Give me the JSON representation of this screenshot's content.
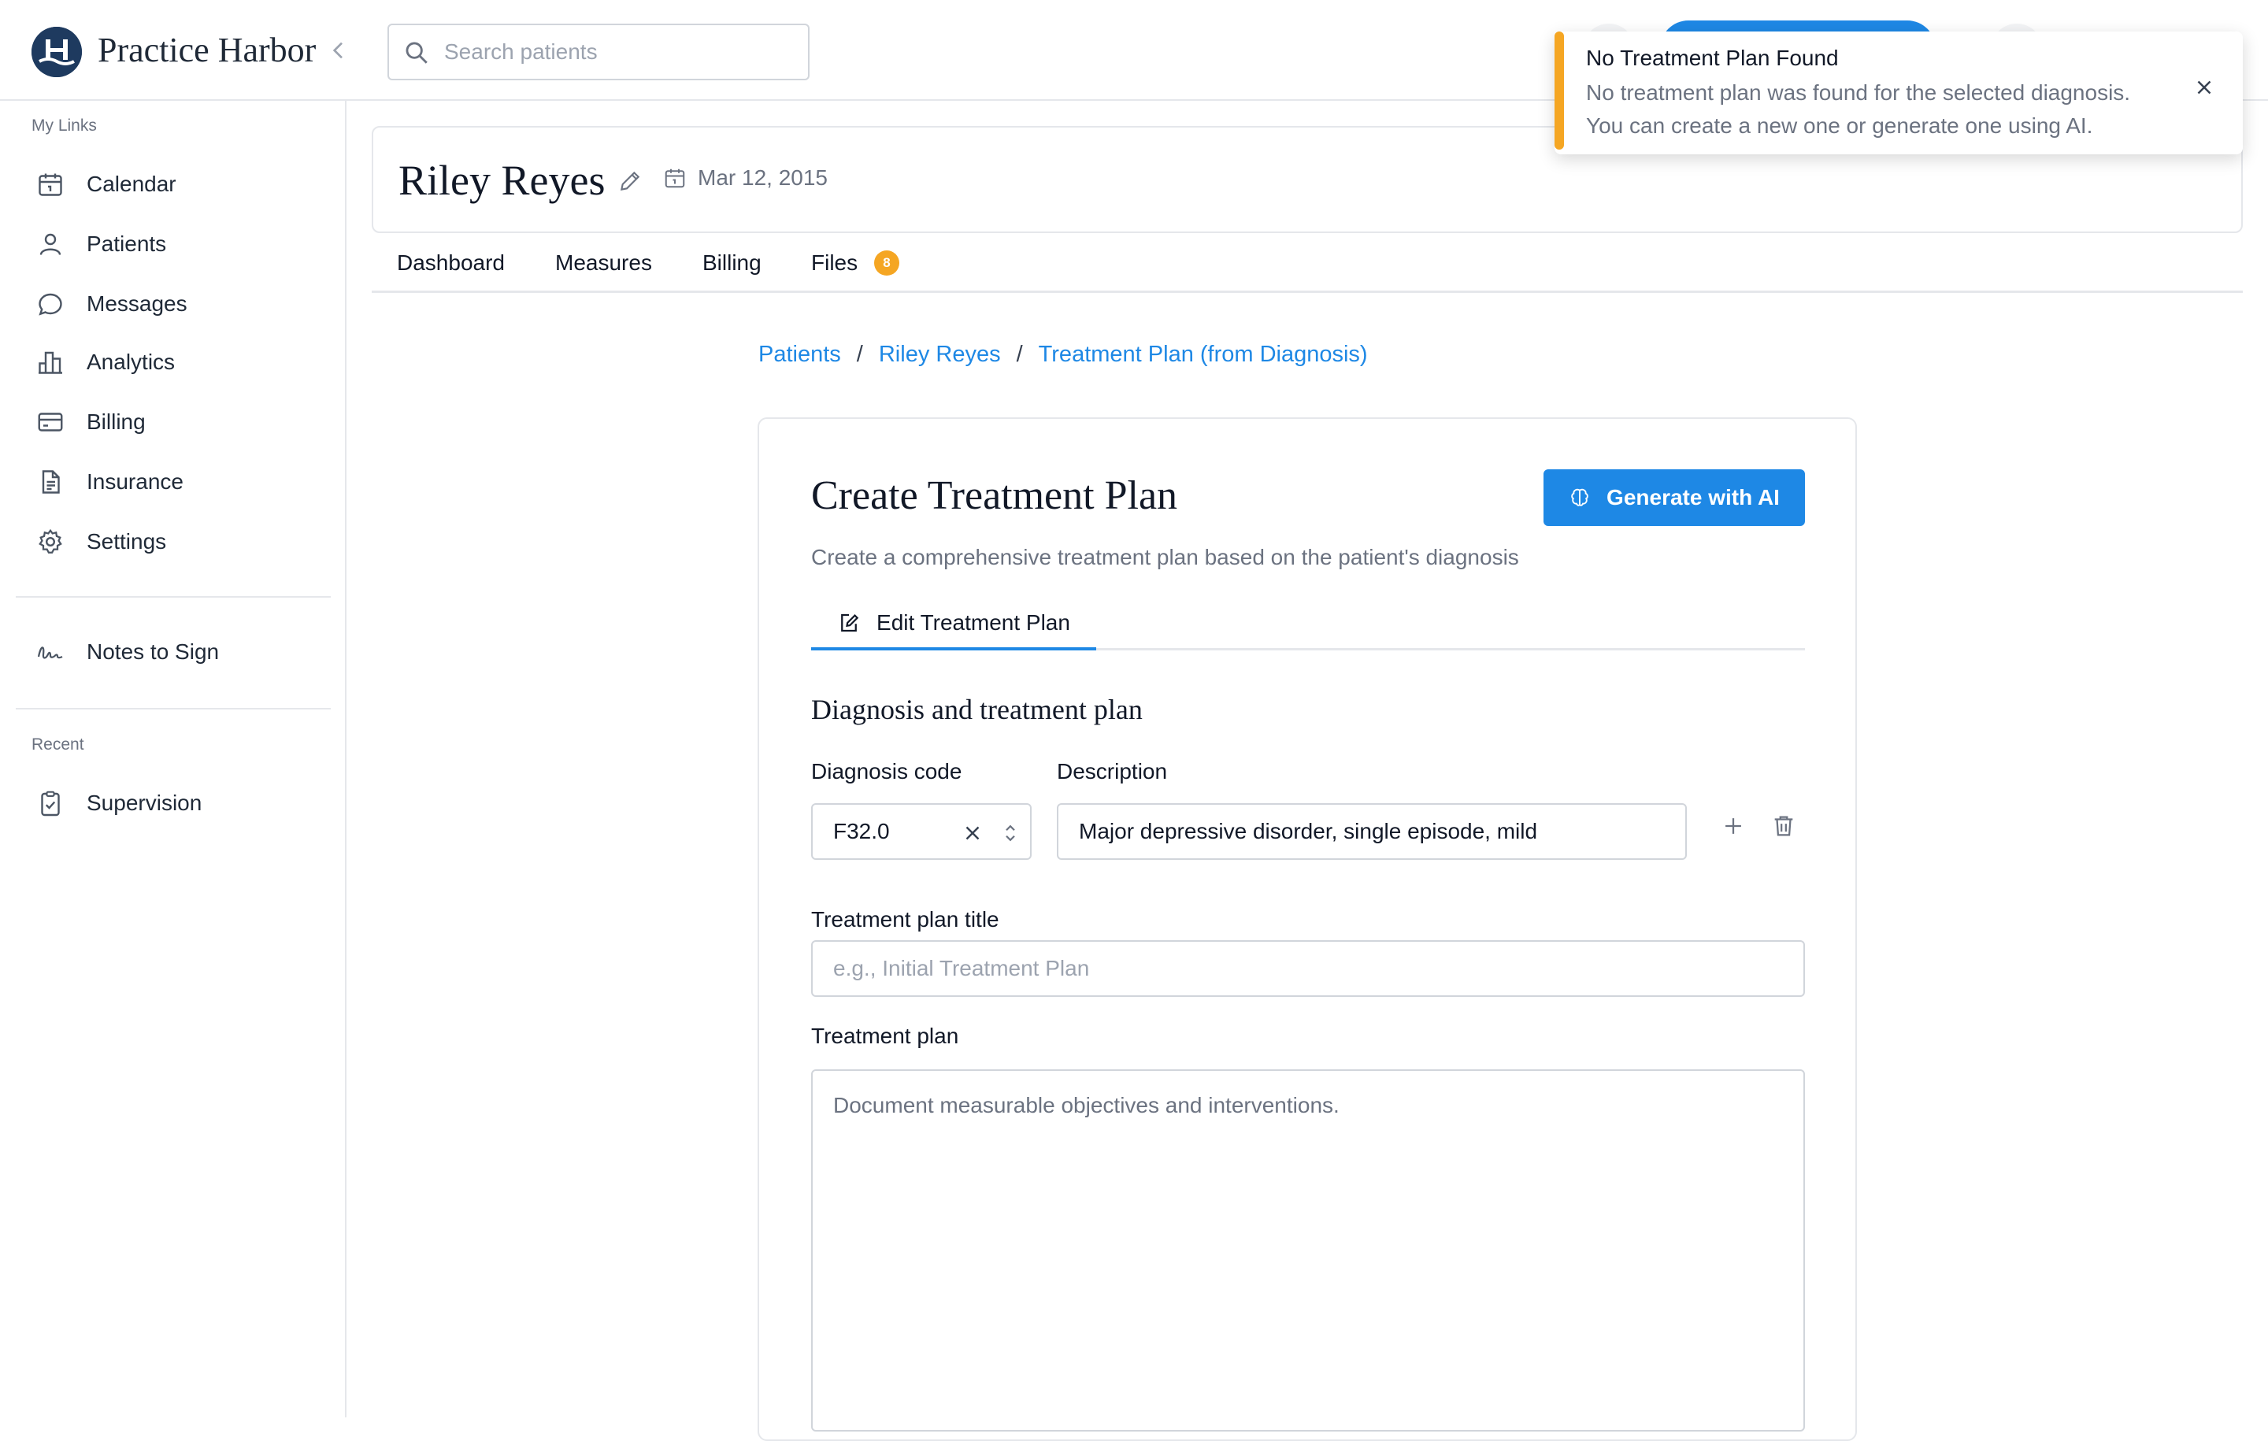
{
  "app": {
    "brand": "Practice Harbor"
  },
  "search": {
    "placeholder": "Search patients"
  },
  "sidebar": {
    "section_links": "My Links",
    "items": [
      {
        "label": "Calendar",
        "icon": "calendar-icon"
      },
      {
        "label": "Patients",
        "icon": "user-icon"
      },
      {
        "label": "Messages",
        "icon": "message-icon"
      },
      {
        "label": "Analytics",
        "icon": "chart-icon"
      },
      {
        "label": "Billing",
        "icon": "credit-card-icon"
      },
      {
        "label": "Insurance",
        "icon": "document-icon"
      },
      {
        "label": "Settings",
        "icon": "gear-icon"
      }
    ],
    "notes": {
      "label": "Notes to Sign",
      "icon": "signature-icon"
    },
    "section_recent": "Recent",
    "recent": [
      {
        "label": "Supervision",
        "icon": "clipboard-check-icon"
      }
    ]
  },
  "patient": {
    "name": "Riley Reyes",
    "dob": "Mar 12, 2015"
  },
  "tabs": [
    {
      "label": "Dashboard"
    },
    {
      "label": "Measures"
    },
    {
      "label": "Billing"
    },
    {
      "label": "Files",
      "badge": "8"
    }
  ],
  "breadcrumb": [
    "Patients",
    "Riley Reyes",
    "Treatment Plan (from Diagnosis)"
  ],
  "form": {
    "title": "Create Treatment Plan",
    "subtitle": "Create a comprehensive treatment plan based on the patient's diagnosis",
    "generate_button": "Generate with AI",
    "tab": "Edit Treatment Plan",
    "section": "Diagnosis and treatment plan",
    "diagnosis_code_label": "Diagnosis code",
    "diagnosis_code_value": "F32.0",
    "description_label": "Description",
    "description_value": "Major depressive disorder, single episode, mild",
    "title_label": "Treatment plan title",
    "title_placeholder": "e.g., Initial Treatment Plan",
    "plan_label": "Treatment plan",
    "plan_placeholder": "Document measurable objectives and interventions."
  },
  "toast": {
    "title": "No Treatment Plan Found",
    "line1": "No treatment plan was found for the selected diagnosis.",
    "line2": "You can create a new one or generate one using AI."
  },
  "colors": {
    "accent": "#1e88e5",
    "warning": "#f5a623",
    "brand_dark": "#1e3a5f"
  }
}
